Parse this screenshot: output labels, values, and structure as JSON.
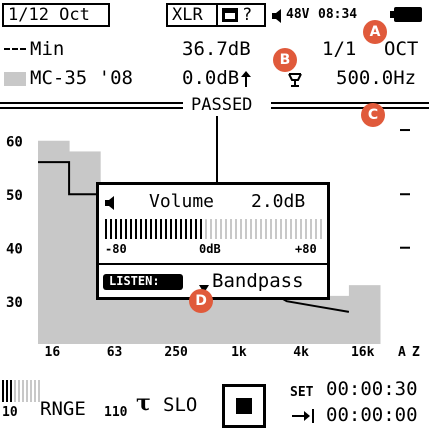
{
  "status_bar": {
    "band_mode": "1/12 Oct",
    "input": "XLR",
    "card_icon": "sd-card-icon",
    "help": "?",
    "phantom": "48V",
    "time": "08:34",
    "battery": "battery-full-icon"
  },
  "meas": {
    "row1": {
      "legend": "Min",
      "level": "36.7dB",
      "band_sel": "1/1",
      "band_unit": "OCT"
    },
    "row2": {
      "legend": "MC-35 '08",
      "offset": "0.0dB",
      "filter": "500.0Hz"
    }
  },
  "result": "PASSED",
  "chart_data": {
    "type": "bar",
    "y_ticks": [
      "60",
      "50",
      "40",
      "30"
    ],
    "x_ticks": [
      "16",
      "63",
      "250",
      "1k",
      "4k",
      "16k"
    ],
    "x_suffix": [
      "A",
      "Z"
    ],
    "ylim": [
      22,
      65
    ],
    "bands": [
      {
        "f": "16",
        "v": 60
      },
      {
        "f": "31.5",
        "v": 58
      },
      {
        "f": "63",
        "v": 49
      },
      {
        "f": "125",
        "v": 44
      },
      {
        "f": "250",
        "v": 41
      },
      {
        "f": "500",
        "v": 38
      },
      {
        "f": "1k",
        "v": 36
      },
      {
        "f": "2k",
        "v": 34
      },
      {
        "f": "4k",
        "v": 32
      },
      {
        "f": "8k",
        "v": 31
      },
      {
        "f": "16k",
        "v": 33
      }
    ],
    "limit_line": [
      {
        "x": 0,
        "y": 56
      },
      {
        "x": 1,
        "y": 56
      },
      {
        "x": 1,
        "y": 50
      },
      {
        "x": 2,
        "y": 50
      },
      {
        "x": 8,
        "y": 30
      },
      {
        "x": 9,
        "y": 29
      },
      {
        "x": 10,
        "y": 28
      }
    ]
  },
  "popup": {
    "title": "Volume",
    "value": "2.0dB",
    "scale_min": "-80",
    "scale_mid": "0dB",
    "scale_max": "+80",
    "listen_label": "LISTEN:",
    "listen_value": "Bandpass"
  },
  "footer": {
    "range_low": "10",
    "range_label": "RNGE",
    "range_high": "110",
    "weighting": "SLO",
    "set_label": "SET",
    "set_time": "00:00:30",
    "elapsed_time": "00:00:00"
  },
  "callouts": [
    "A",
    "B",
    "C",
    "D"
  ]
}
